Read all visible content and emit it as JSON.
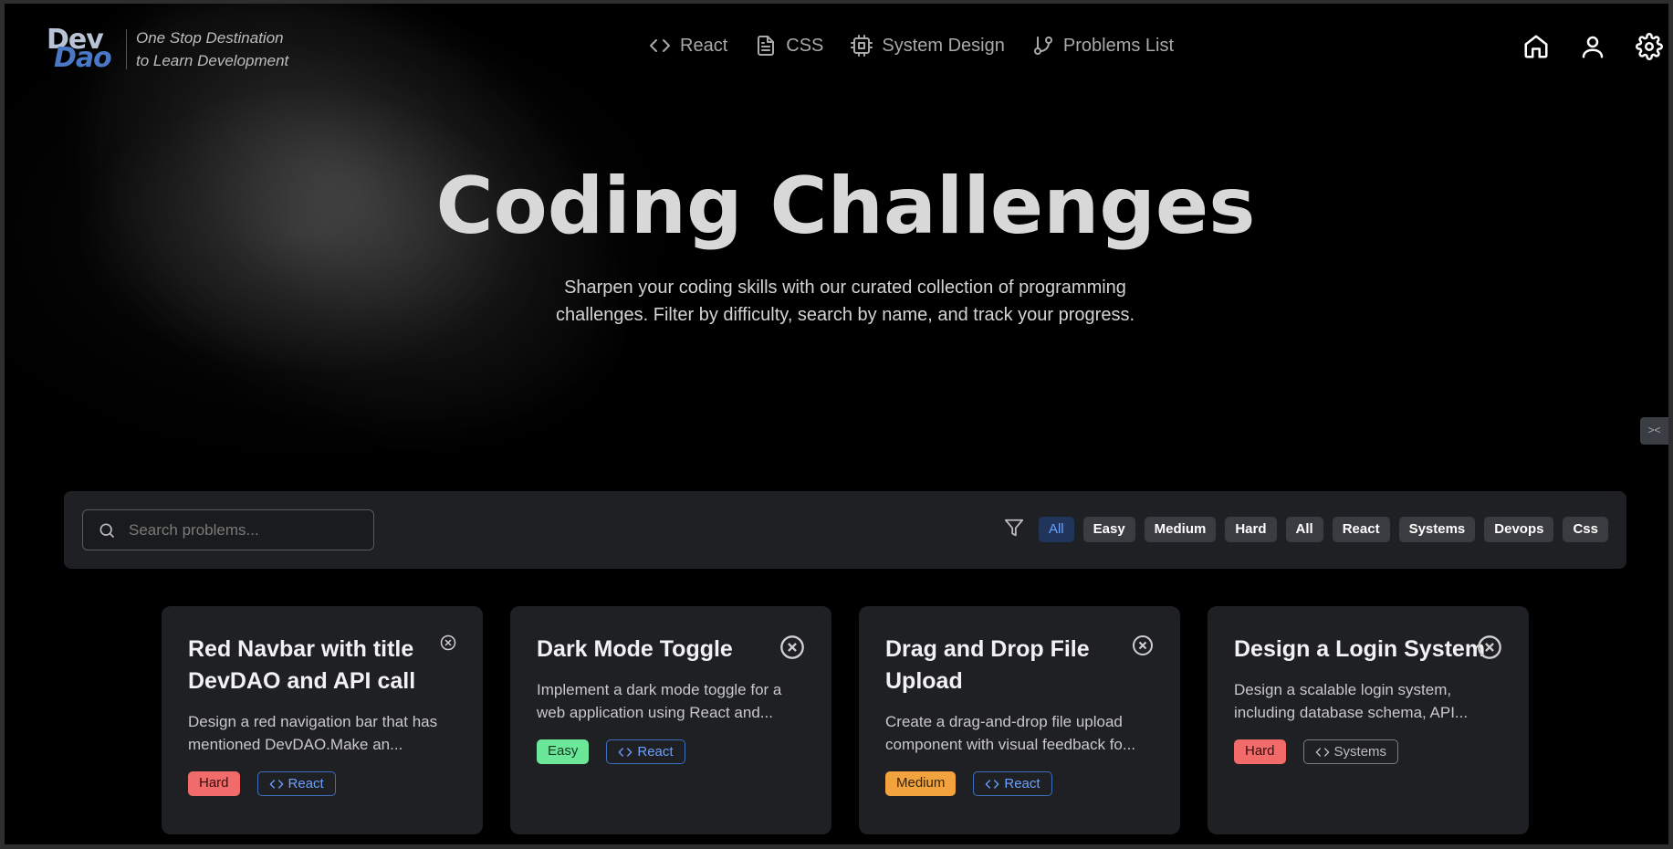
{
  "header": {
    "logo_top": "Dev",
    "logo_bottom": "Dao",
    "tagline_line1": "One Stop Destination",
    "tagline_line2": "to Learn Development",
    "nav": [
      {
        "label": "React",
        "icon": "code-icon"
      },
      {
        "label": "CSS",
        "icon": "document-icon"
      },
      {
        "label": "System Design",
        "icon": "cpu-icon"
      },
      {
        "label": "Problems List",
        "icon": "git-branch-icon"
      }
    ],
    "right_icons": [
      "home-icon",
      "user-icon",
      "settings-gear-icon"
    ]
  },
  "hero": {
    "title": "Coding Challenges",
    "subtitle": "Sharpen your coding skills with our curated collection of programming challenges. Filter by difficulty, search by name, and track your progress."
  },
  "side_toggle": "><",
  "filters": {
    "search_placeholder": "Search problems...",
    "chips": [
      "All",
      "Easy",
      "Medium",
      "Hard",
      "All",
      "React",
      "Systems",
      "Devops",
      "Css"
    ],
    "active_index": 0
  },
  "cards": [
    {
      "title": "Red Navbar with title DevDAO and API call",
      "description": "Design a red navigation bar that has mentioned DevDAO.Make an...",
      "difficulty": "Hard",
      "category": "React"
    },
    {
      "title": "Dark Mode Toggle",
      "description": "Implement a dark mode toggle for a web application using React and...",
      "difficulty": "Easy",
      "category": "React"
    },
    {
      "title": "Drag and Drop File Upload",
      "description": "Create a drag-and-drop file upload component with visual feedback fo...",
      "difficulty": "Medium",
      "category": "React"
    },
    {
      "title": "Design a Login System",
      "description": "Design a scalable login system, including database schema, API...",
      "difficulty": "Hard",
      "category": "Systems"
    }
  ],
  "colors": {
    "hard": "#f16b6b",
    "easy": "#6ce79a",
    "medium": "#f2a33e",
    "accent": "#6aa0ff"
  }
}
